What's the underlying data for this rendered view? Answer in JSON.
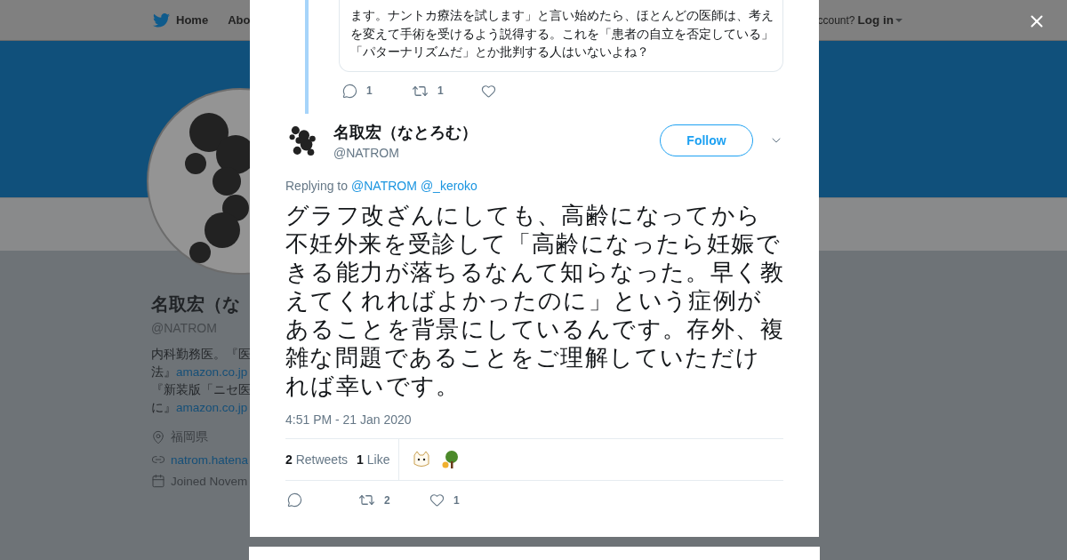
{
  "topbar": {
    "nav": [
      {
        "label": "Home"
      },
      {
        "label": "Abo"
      }
    ],
    "account_prompt": "ccount?",
    "login": "Log in"
  },
  "profile": {
    "name": "名取宏（な",
    "handle": "@NATROM",
    "bio": [
      {
        "text": "内科勤務医。『医"
      },
      {
        "text": "法』",
        "link": "amazon.co.jp"
      },
      {
        "text": "『新装版「ニセ医"
      },
      {
        "text": "に』",
        "link": "amazon.co.jp"
      }
    ],
    "location": "福岡県",
    "website": "natrom.hatena",
    "joined": "Joined Novem"
  },
  "modal": {
    "parent_tweet": {
      "lines": [
        "ます。ナントカ療法を試します」と言い始めたら、ほとんどの医師は、考え",
        "を変えて手術を受けるよう説得する。これを「患者の自立を否定している」",
        "「パターナリズムだ」とか批判する人はいないよね？"
      ],
      "actions": [
        {
          "kind": "reply",
          "count": "1"
        },
        {
          "kind": "retweet",
          "count": "1"
        },
        {
          "kind": "like"
        }
      ]
    },
    "tweet": {
      "name": "名取宏（なとろむ）",
      "handle": "@NATROM",
      "follow_label": "Follow",
      "replying_label": "Replying to",
      "replying_to": [
        "@NATROM",
        "@_keroko"
      ],
      "lines": [
        "グラフ改ざんにしても、高齢になってから",
        "不妊外来を受診して「高齢になったら妊娠で",
        "きる能力が落ちるなんて知らなった。早く教",
        "えてくれればよかったのに」という症例が",
        "あることを背景にしているんです。存外、複",
        "雑な問題であることをご理解していただけ",
        "れば幸いです。"
      ],
      "timestamp": "4:51 PM - 21 Jan 2020",
      "stats": [
        {
          "count": "2",
          "label": "Retweets"
        },
        {
          "count": "1",
          "label": "Like"
        }
      ],
      "liked_by": [
        {
          "kind": "picture"
        },
        {
          "kind": "picture"
        }
      ],
      "actions": [
        {
          "kind": "reply"
        },
        {
          "kind": "retweet",
          "count": "2"
        },
        {
          "kind": "like",
          "count": "1"
        }
      ]
    }
  }
}
